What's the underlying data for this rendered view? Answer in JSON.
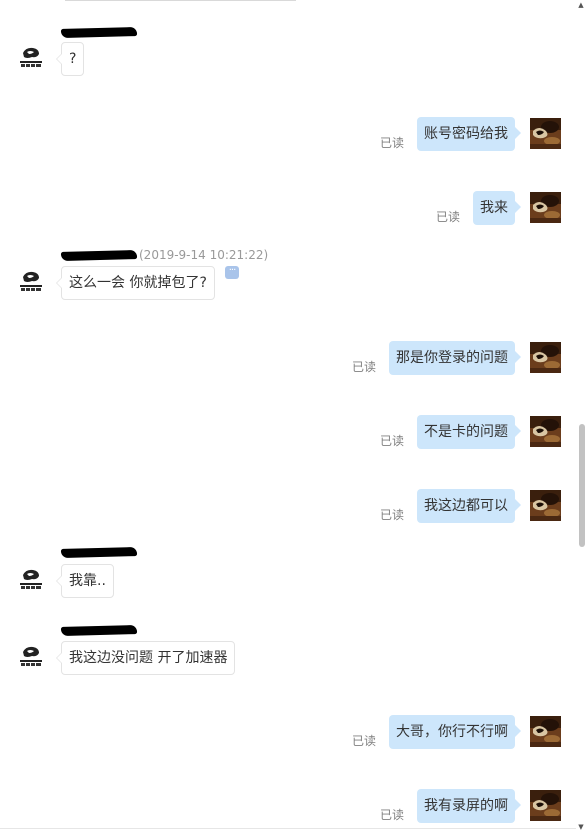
{
  "read_label": "已读",
  "icons": {
    "incoming_avatar": "game-logo-avatar-icon",
    "outgoing_avatar": "photo-avatar-icon",
    "more_button": "more-icon",
    "scroll_up": "scroll-up-arrow-icon",
    "scroll_down": "scroll-down-arrow-icon"
  },
  "colors": {
    "outgoing_bubble": "#cde6fb",
    "incoming_bubble": "#ffffff",
    "incoming_border": "#e3e3e3",
    "read_text": "#808080",
    "timestamp_text": "#999999",
    "more_icon": "#a9c4ea"
  },
  "glyphs": {
    "more": "···",
    "scroll_up": "▲",
    "scroll_down": "▼"
  },
  "messages": [
    {
      "direction": "in",
      "sender_redacted": true,
      "time": "",
      "text": "?"
    },
    {
      "direction": "out",
      "read": true,
      "text": "账号密码给我"
    },
    {
      "direction": "out",
      "read": true,
      "text": "我来"
    },
    {
      "direction": "in",
      "sender_redacted": true,
      "time": "(2019-9-14 10:21:22)",
      "text": "这么一会 你就掉包了?",
      "has_more_button": true
    },
    {
      "direction": "out",
      "read": true,
      "text": "那是你登录的问题"
    },
    {
      "direction": "out",
      "read": true,
      "text": "不是卡的问题"
    },
    {
      "direction": "out",
      "read": true,
      "text": "我这边都可以"
    },
    {
      "direction": "in",
      "sender_redacted": true,
      "time": "",
      "text": "我靠.."
    },
    {
      "direction": "in",
      "sender_redacted": true,
      "time": "",
      "text": "我这边没问题 开了加速器"
    },
    {
      "direction": "out",
      "read": true,
      "text": "大哥，你行不行啊"
    },
    {
      "direction": "out",
      "read": true,
      "text": "我有录屏的啊"
    }
  ]
}
